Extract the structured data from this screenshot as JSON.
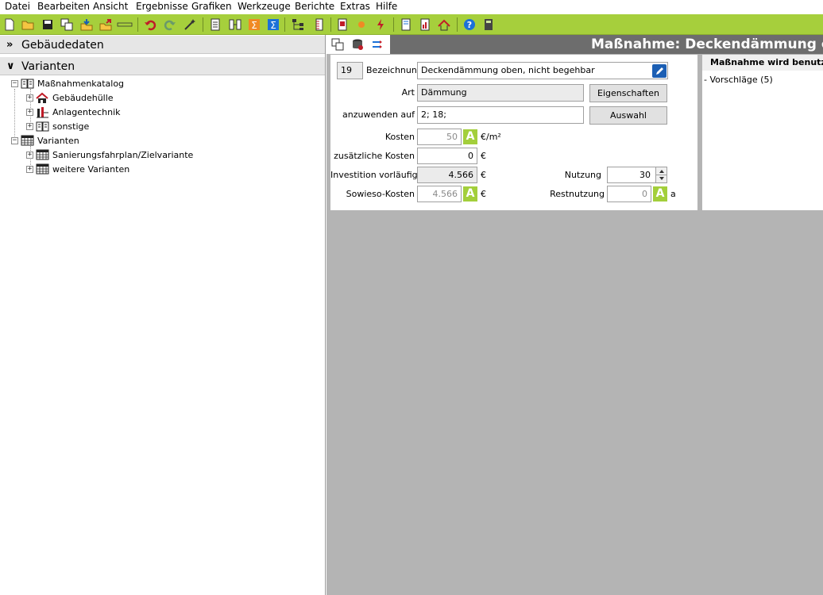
{
  "menu": [
    "Datei",
    "Bearbeiten",
    "Ansicht",
    "Ergebnisse",
    "Grafiken",
    "Werkzeuge",
    "Berichte",
    "Extras",
    "Hilfe"
  ],
  "toolbar_icons": [
    "new-file-icon",
    "open-folder-icon",
    "save-icon",
    "copy-icon",
    "import-icon",
    "export-icon",
    "building-text-icon",
    "undo-icon",
    "redo-icon",
    "wizard-icon",
    "document-icon",
    "compare-icon",
    "sum-orange-icon",
    "sum-blue-icon",
    "tree-icon",
    "ruler-icon",
    "form-icon",
    "sun-icon",
    "energy-icon",
    "report-icon",
    "report-chart-icon",
    "roof-icon",
    "help-icon",
    "calculator-icon"
  ],
  "left": {
    "sections": [
      {
        "chevron": "»",
        "label": "Gebäudedaten"
      },
      {
        "chevron": "¥",
        "label": "Varianten"
      }
    ],
    "tree": [
      {
        "label": "Maßnahmenkatalog",
        "icon": "book-icon",
        "level": 0
      },
      {
        "label": "Gebäudehülle",
        "icon": "house-icon",
        "level": 1
      },
      {
        "label": "Anlagentechnik",
        "icon": "heating-icon",
        "level": 1
      },
      {
        "label": "sonstige",
        "icon": "book-icon",
        "level": 1
      },
      {
        "label": "Varianten",
        "icon": "table-icon",
        "level": 0
      },
      {
        "label": "Sanierungsfahrplan/Zielvariante",
        "icon": "table-icon",
        "level": 1
      },
      {
        "label": "weitere Varianten",
        "icon": "table-icon",
        "level": 1
      }
    ]
  },
  "title": "Maßnahme: Deckendämmung oben,",
  "form": {
    "id": "19",
    "bezeichnung_label": "Bezeichnung",
    "bezeichnung_value": "Deckendämmung oben, nicht begehbar",
    "art_label": "Art",
    "art_value": "Dämmung",
    "eigenschaften_button": "Eigenschaften",
    "anzuwenden_label": "anzuwenden auf",
    "anzuwenden_value": "2; 18;",
    "auswahl_button": "Auswahl",
    "kosten_label": "Kosten",
    "kosten_value": "50",
    "kosten_unit": "€/m²",
    "zusaetzlich_label": "zusätzliche Kosten",
    "zusaetzlich_value": "0",
    "zusaetzlich_unit": "€",
    "investition_label": "Investition vorläufig",
    "investition_value": "4.566",
    "investition_unit": "€",
    "sowieso_label": "Sowieso-Kosten",
    "sowieso_value": "4.566",
    "sowieso_unit": "€",
    "nutzung_label": "Nutzung",
    "nutzung_value": "30",
    "restnutzung_label": "Restnutzung",
    "restnutzung_value": "0",
    "restnutzung_unit": "a",
    "a_button": "A"
  },
  "used": {
    "header": "Maßnahme wird benutzt i",
    "item": "- Vorschläge (5)"
  },
  "colors": {
    "toolbar": "#a6cf3c",
    "accent_button": "#a3cf3b",
    "title_bar": "#6d6d6d",
    "workspace": "#b4b4b4"
  }
}
